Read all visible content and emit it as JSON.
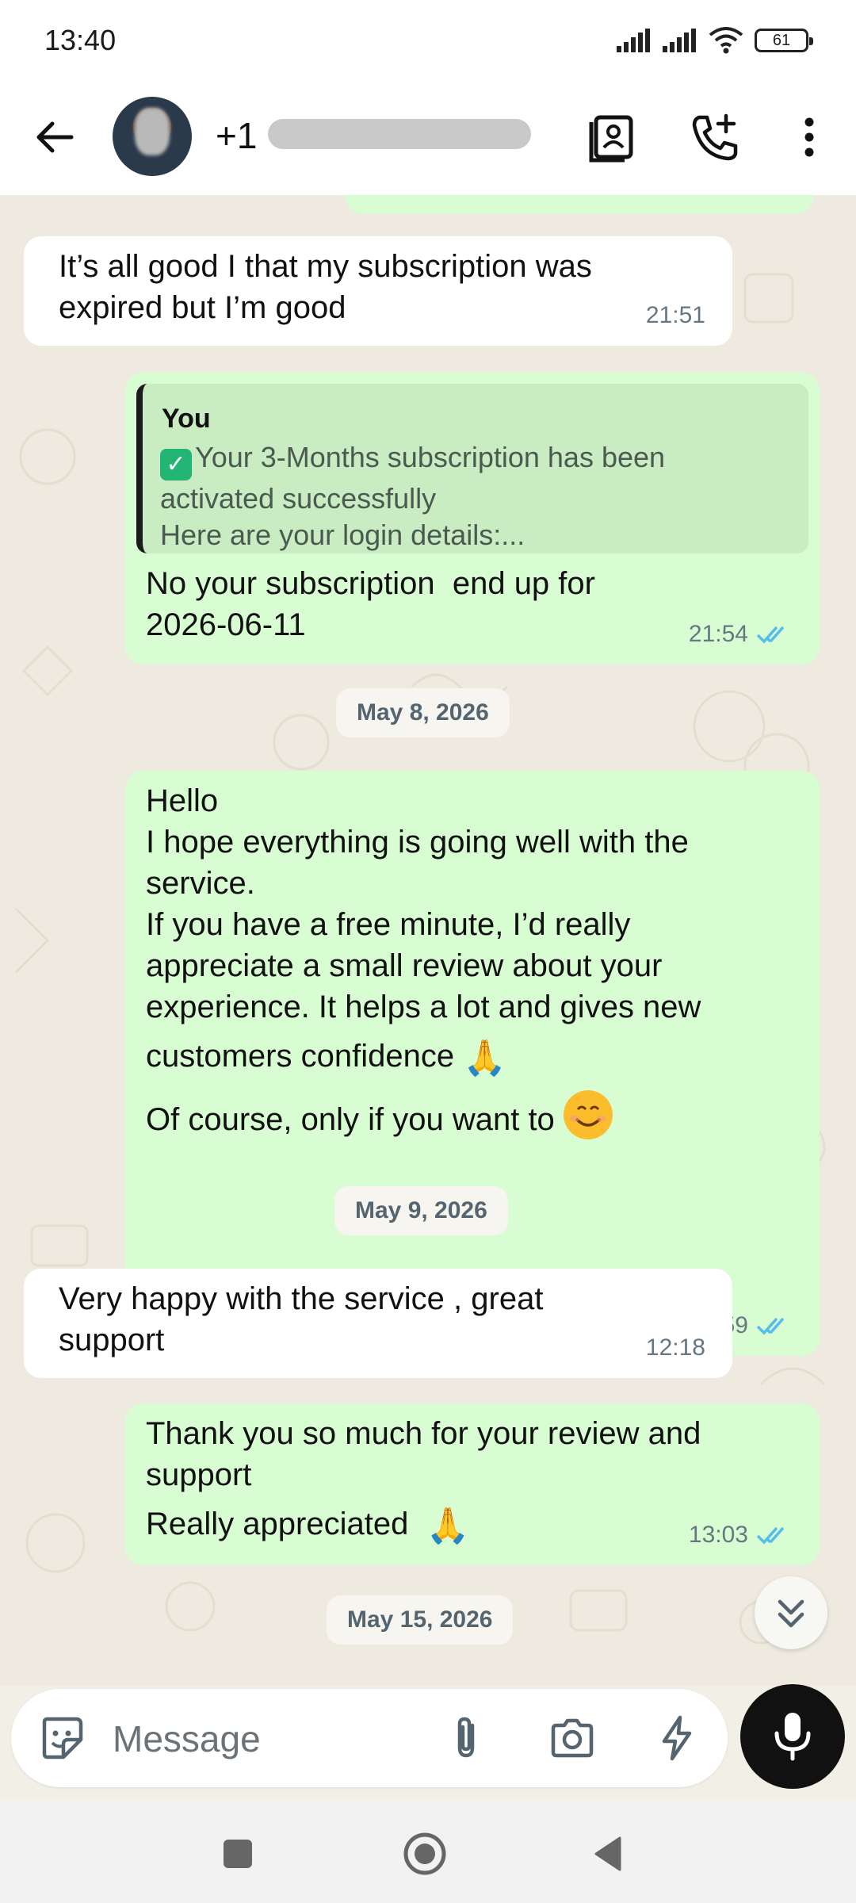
{
  "status_bar": {
    "time": "13:40",
    "battery": "61"
  },
  "header": {
    "contact_name": "+1",
    "icons": [
      "back-arrow-icon",
      "contact-card-icon",
      "add-call-icon",
      "more-vert-icon"
    ]
  },
  "messages": [
    {
      "direction": "in",
      "text": "It’s all good I that my subscription was\nexpired but I’m good",
      "time": "21:51"
    },
    {
      "direction": "out",
      "quote": {
        "author": "You",
        "text": "Your 3-Months subscription has been\nactivated successfully\nHere are your login details:..."
      },
      "text": "No your subscription  end up for\n2026-06-11",
      "time": "21:54",
      "status": "read"
    },
    {
      "type": "date",
      "label": "May 8, 2026"
    },
    {
      "direction": "out",
      "text_lines": [
        "Hello",
        "I hope everything is going well with the",
        "service.",
        "If you have a free minute, I’d really",
        "appreciate a small review about your",
        "experience. It helps a lot and gives new",
        "customers confidence",
        "Of course, only if you want to"
      ],
      "time": "16:59",
      "status": "read"
    },
    {
      "type": "date",
      "label": "May 9, 2026"
    },
    {
      "direction": "in",
      "text": "Very happy with the service , great\nsupport",
      "time": "12:18"
    },
    {
      "direction": "out",
      "text_lines": [
        "Thank you so much for your review and",
        "support",
        "Really appreciated"
      ],
      "time": "13:03",
      "status": "read"
    },
    {
      "type": "date",
      "label": "May 15, 2026"
    }
  ],
  "input": {
    "placeholder": "Message"
  },
  "colors": {
    "outgoing_bubble": "#d9fdd3",
    "incoming_bubble": "#ffffff",
    "chat_background": "#efeae0",
    "read_ticks": "#53bdeb",
    "mic_button": "#111111"
  }
}
